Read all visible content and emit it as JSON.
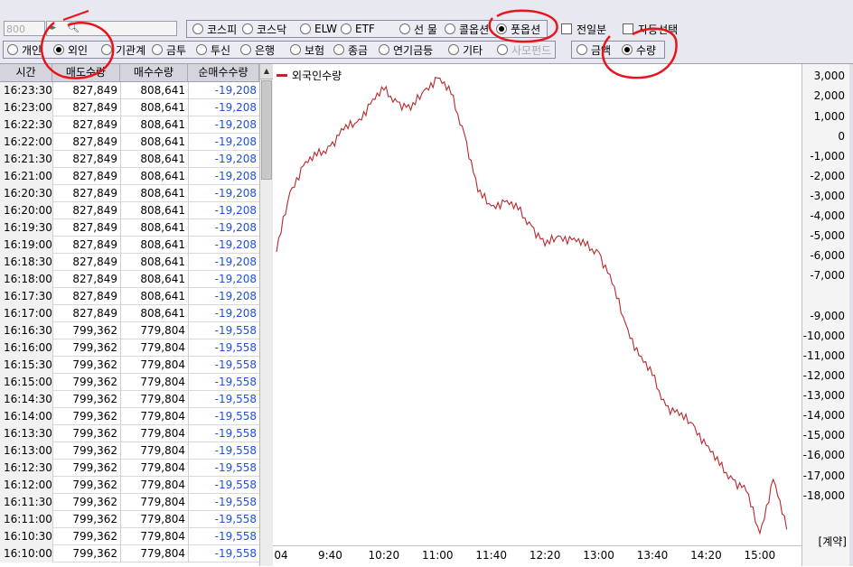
{
  "toolbar": {
    "code_value": "800",
    "search_icon": "magnifier-icon",
    "market_options": [
      {
        "label": "코스피",
        "selected": false
      },
      {
        "label": "코스닥",
        "selected": false
      },
      {
        "label": "ELW",
        "selected": false
      },
      {
        "label": "ETF",
        "selected": false
      },
      {
        "label": "선 물",
        "selected": false
      },
      {
        "label": "콜옵션",
        "selected": false
      },
      {
        "label": "풋옵션",
        "selected": true
      }
    ],
    "prev_day_label": "전일분",
    "auto_select_label": "자동선택",
    "investor_options": [
      {
        "label": "개인",
        "selected": false
      },
      {
        "label": "외인",
        "selected": true
      },
      {
        "label": "기관계",
        "selected": false
      },
      {
        "label": "금투",
        "selected": false
      },
      {
        "label": "투신",
        "selected": false
      },
      {
        "label": "은행",
        "selected": false
      },
      {
        "label": "보험",
        "selected": false
      },
      {
        "label": "종금",
        "selected": false
      },
      {
        "label": "연기금등",
        "selected": false
      },
      {
        "label": "기타",
        "selected": false
      },
      {
        "label": "사모펀드",
        "selected": false,
        "disabled": true
      }
    ],
    "unit_options": [
      {
        "label": "금액",
        "selected": false
      },
      {
        "label": "수량",
        "selected": true
      }
    ]
  },
  "table": {
    "headers": [
      "시간",
      "매도수량",
      "매수수량",
      "순매수수량"
    ],
    "rows": [
      [
        "16:23:30",
        "827,849",
        "808,641",
        "-19,208"
      ],
      [
        "16:23:00",
        "827,849",
        "808,641",
        "-19,208"
      ],
      [
        "16:22:30",
        "827,849",
        "808,641",
        "-19,208"
      ],
      [
        "16:22:00",
        "827,849",
        "808,641",
        "-19,208"
      ],
      [
        "16:21:30",
        "827,849",
        "808,641",
        "-19,208"
      ],
      [
        "16:21:00",
        "827,849",
        "808,641",
        "-19,208"
      ],
      [
        "16:20:30",
        "827,849",
        "808,641",
        "-19,208"
      ],
      [
        "16:20:00",
        "827,849",
        "808,641",
        "-19,208"
      ],
      [
        "16:19:30",
        "827,849",
        "808,641",
        "-19,208"
      ],
      [
        "16:19:00",
        "827,849",
        "808,641",
        "-19,208"
      ],
      [
        "16:18:30",
        "827,849",
        "808,641",
        "-19,208"
      ],
      [
        "16:18:00",
        "827,849",
        "808,641",
        "-19,208"
      ],
      [
        "16:17:30",
        "827,849",
        "808,641",
        "-19,208"
      ],
      [
        "16:17:00",
        "827,849",
        "808,641",
        "-19,208"
      ],
      [
        "16:16:30",
        "799,362",
        "779,804",
        "-19,558"
      ],
      [
        "16:16:00",
        "799,362",
        "779,804",
        "-19,558"
      ],
      [
        "16:15:30",
        "799,362",
        "779,804",
        "-19,558"
      ],
      [
        "16:15:00",
        "799,362",
        "779,804",
        "-19,558"
      ],
      [
        "16:14:30",
        "799,362",
        "779,804",
        "-19,558"
      ],
      [
        "16:14:00",
        "799,362",
        "779,804",
        "-19,558"
      ],
      [
        "16:13:30",
        "799,362",
        "779,804",
        "-19,558"
      ],
      [
        "16:13:00",
        "799,362",
        "779,804",
        "-19,558"
      ],
      [
        "16:12:30",
        "799,362",
        "779,804",
        "-19,558"
      ],
      [
        "16:12:00",
        "799,362",
        "779,804",
        "-19,558"
      ],
      [
        "16:11:30",
        "799,362",
        "779,804",
        "-19,558"
      ],
      [
        "16:11:00",
        "799,362",
        "779,804",
        "-19,558"
      ],
      [
        "16:10:30",
        "799,362",
        "779,804",
        "-19,558"
      ],
      [
        "16:10:00",
        "799,362",
        "779,804",
        "-19,558"
      ]
    ]
  },
  "chart_data": {
    "type": "line",
    "title": "",
    "xlabel": "",
    "ylabel": "",
    "unit_label": "[계약]",
    "series": [
      {
        "name": "외국인수량",
        "color": "#b8282c",
        "x": [
          "09:00",
          "09:10",
          "09:20",
          "09:30",
          "09:40",
          "09:50",
          "10:00",
          "10:10",
          "10:20",
          "10:30",
          "10:40",
          "10:50",
          "11:00",
          "11:10",
          "11:20",
          "11:30",
          "11:40",
          "11:50",
          "12:00",
          "12:10",
          "12:20",
          "12:30",
          "12:40",
          "12:50",
          "13:00",
          "13:10",
          "13:20",
          "13:30",
          "13:40",
          "13:50",
          "14:00",
          "14:10",
          "14:20",
          "14:30",
          "14:40",
          "14:50",
          "15:00",
          "15:10",
          "15:20"
        ],
        "y": [
          -5800,
          -2800,
          -1500,
          -1000,
          -500,
          300,
          700,
          1600,
          2300,
          1700,
          1300,
          2300,
          2900,
          2100,
          100,
          -2800,
          -3500,
          -3300,
          -3700,
          -4500,
          -5500,
          -5000,
          -5200,
          -5500,
          -5800,
          -7400,
          -9400,
          -11000,
          -12000,
          -13500,
          -14000,
          -14400,
          -15500,
          -16500,
          -17200,
          -17800,
          -19900,
          -17200,
          -19700
        ]
      }
    ],
    "x_ticks": [
      "04",
      "9:40",
      "10:20",
      "11:00",
      "11:40",
      "12:20",
      "13:00",
      "13:40",
      "14:20",
      "15:00"
    ],
    "y_ticks": [
      3000,
      2000,
      1000,
      0,
      -1000,
      -2000,
      -3000,
      -4000,
      -5000,
      -6000,
      -7000,
      -8000,
      -9000,
      -10000,
      -11000,
      -12000,
      -13000,
      -14000,
      -15000,
      -16000,
      -17000,
      -18000
    ],
    "y_tick_labels": [
      "3,000",
      "2,000",
      "1,000",
      "0",
      "-1,000",
      "-2,000",
      "-3,000",
      "-4,000",
      "-5,000",
      "-6,000",
      "-7,000",
      "-9,000",
      "-10,000",
      "-11,000",
      "-12,000",
      "-13,000",
      "-14,000",
      "-15,000",
      "-16,000",
      "-17,000",
      "-18,000"
    ],
    "ylim": [
      -20500,
      3600
    ],
    "grid": false,
    "legend": "top-left"
  },
  "colors": {
    "accent_red": "#b8282c",
    "negative_blue": "#1f4fe0",
    "annotation_red": "#e8141c"
  }
}
